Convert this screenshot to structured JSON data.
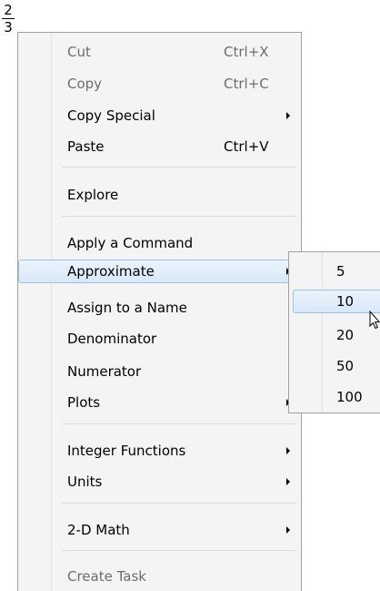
{
  "expression": {
    "numerator": "2",
    "denominator": "3"
  },
  "context_menu": {
    "items": [
      {
        "label": "Cut",
        "shortcut": "Ctrl+X",
        "enabled": false
      },
      {
        "label": "Copy",
        "shortcut": "Ctrl+C",
        "enabled": false
      },
      {
        "label": "Copy Special",
        "has_submenu": true
      },
      {
        "label": "Paste",
        "shortcut": "Ctrl+V"
      },
      {
        "label": "Explore"
      },
      {
        "label": "Apply a Command"
      },
      {
        "label": "Approximate",
        "has_submenu": true,
        "highlighted": true
      },
      {
        "label": "Assign to a Name"
      },
      {
        "label": "Denominator"
      },
      {
        "label": "Numerator"
      },
      {
        "label": "Plots",
        "has_submenu": true
      },
      {
        "label": "Integer Functions",
        "has_submenu": true
      },
      {
        "label": "Units",
        "has_submenu": true
      },
      {
        "label": "2-D Math",
        "has_submenu": true
      },
      {
        "label": "Create Task",
        "enabled": false
      }
    ]
  },
  "approximate_submenu": {
    "items": [
      {
        "label": "5"
      },
      {
        "label": "10",
        "highlighted": true
      },
      {
        "label": "20"
      },
      {
        "label": "50"
      },
      {
        "label": "100"
      }
    ]
  },
  "colors": {
    "menu_background": "#f4f4f4",
    "highlight_border": "#9ec0e4",
    "disabled_text": "#6d6d6d"
  }
}
